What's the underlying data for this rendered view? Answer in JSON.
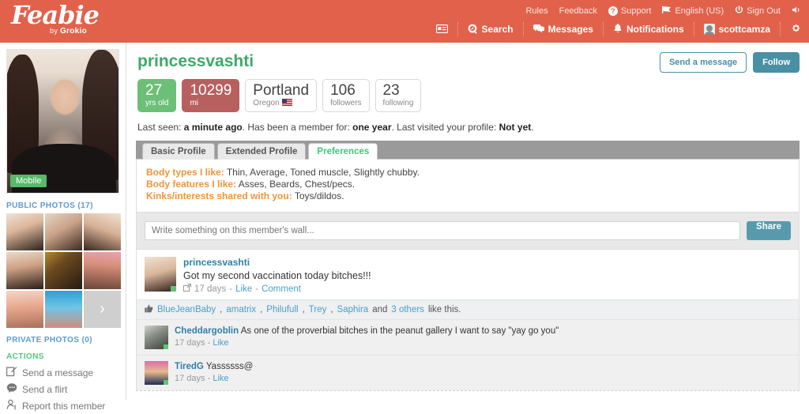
{
  "brand": {
    "name": "Feabie",
    "by_prefix": "by",
    "by_name": "Grokio",
    "accent": "#e2614a"
  },
  "topbar": {
    "utility": [
      {
        "label": "Rules",
        "icon": ""
      },
      {
        "label": "Feedback",
        "icon": ""
      },
      {
        "label": "Support",
        "icon": "question-circle-icon"
      },
      {
        "label": "English (US)",
        "icon": "flag-icon"
      },
      {
        "label": "Sign Out",
        "icon": "power-icon"
      },
      {
        "label": "",
        "icon": "volume-icon"
      }
    ],
    "nav": [
      {
        "label": "",
        "icon": "card-icon"
      },
      {
        "label": "Search",
        "icon": "search-icon"
      },
      {
        "label": "Messages",
        "icon": "messages-icon"
      },
      {
        "label": "Notifications",
        "icon": "bell-icon"
      },
      {
        "label": "scottcamza",
        "icon": "avatar-icon"
      },
      {
        "label": "",
        "icon": "gear-icon"
      }
    ]
  },
  "sidebar": {
    "photo_badge": "Mobile",
    "public_photos_title": "PUBLIC PHOTOS (17)",
    "private_photos_title": "PRIVATE PHOTOS (0)",
    "more_glyph": "›",
    "actions_title": "ACTIONS",
    "actions": [
      {
        "label": "Send a message",
        "icon": "compose-icon"
      },
      {
        "label": "Send a flirt",
        "icon": "speech-bubble-icon"
      },
      {
        "label": "Report this member",
        "icon": "report-user-icon"
      }
    ]
  },
  "profile": {
    "username": "princessvashti",
    "buttons": {
      "message": "Send a message",
      "follow": "Follow"
    },
    "stats": [
      {
        "value": "27",
        "label": "yrs old",
        "style": "green"
      },
      {
        "value": "10299",
        "label": "mi",
        "style": "red"
      },
      {
        "value": "Portland",
        "label": "Oregon",
        "style": "plain",
        "flag": true
      },
      {
        "value": "106",
        "label": "followers",
        "style": "plain"
      },
      {
        "value": "23",
        "label": "following",
        "style": "plain"
      }
    ],
    "last_seen": {
      "l1": "Last seen: ",
      "v1": "a minute ago",
      "l2": ". Has been a member for: ",
      "v2": "one year",
      "l3": ". Last visited your profile: ",
      "v3": "Not yet",
      "l4": "."
    },
    "tabs": [
      {
        "label": "Basic Profile",
        "active": false
      },
      {
        "label": "Extended Profile",
        "active": false
      },
      {
        "label": "Preferences",
        "active": true
      }
    ],
    "preferences": [
      {
        "label": "Body types I like:",
        "value": "Thin, Average, Toned muscle, Slightly chubby."
      },
      {
        "label": "Body features I like:",
        "value": "Asses, Beards, Chest/pecs."
      },
      {
        "label": "Kinks/interests shared with you:",
        "value": "Toys/dildos."
      }
    ]
  },
  "wall": {
    "input_placeholder": "Write something on this member's wall...",
    "share_label": "Share",
    "post": {
      "author": "princessvashti",
      "text": "Got my second vaccination today bitches!!!",
      "time": "17 days",
      "sep": "-",
      "like": "Like",
      "comment": "Comment",
      "likes": {
        "names": [
          "BlueJeanBaby",
          "amatrix",
          "Philufull",
          "Trey",
          "Saphira"
        ],
        "conj": "and",
        "others": "3 others",
        "suffix": "like this."
      },
      "comments": [
        {
          "author": "Cheddargoblin",
          "text": "As one of the proverbial bitches in the peanut gallery I want to say \"yay go you\"",
          "time": "17 days",
          "sep": "-",
          "like": "Like"
        },
        {
          "author": "TiredG",
          "text": "Yassssss@",
          "time": "17 days",
          "sep": "-",
          "like": "Like"
        }
      ]
    }
  }
}
